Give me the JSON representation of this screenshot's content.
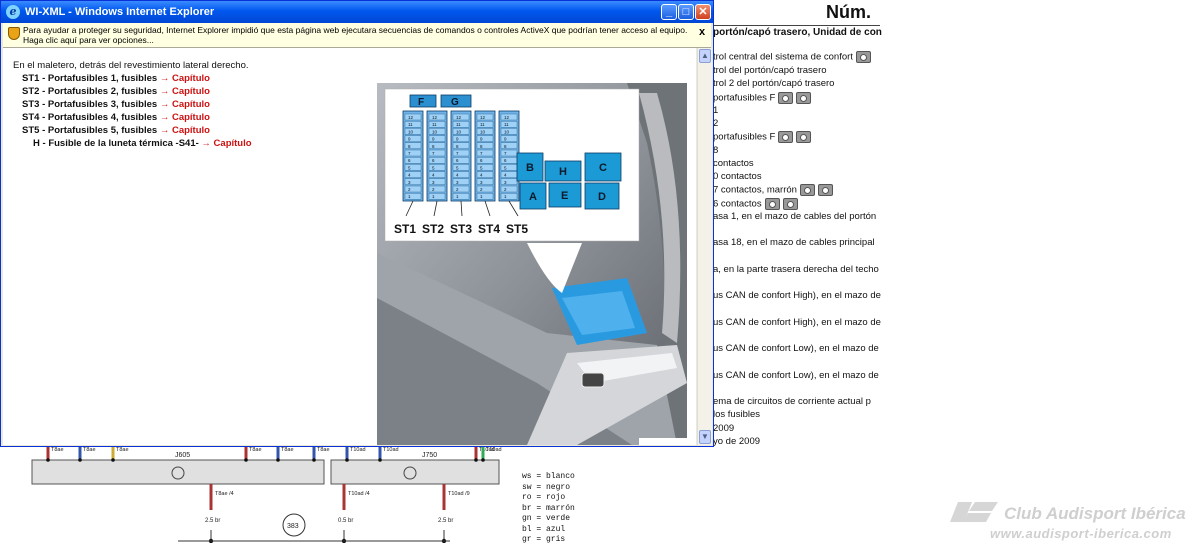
{
  "window": {
    "title": "WI-XML - Windows Internet Explorer",
    "minimize_label": "_",
    "maximize_label": "□",
    "close_label": "✕",
    "icon": "ie-logo-icon"
  },
  "infobar": {
    "text": "Para ayudar a proteger su seguridad, Internet Explorer impidió que esta página web ejecutara secuencias de comandos o controles ActiveX que podrían tener acceso al equipo. Haga clic aquí para ver opciones...",
    "close_label": "x"
  },
  "content": {
    "intro": "En el maletero, detrás del revestimiento lateral derecho.",
    "fuses": [
      {
        "code": "ST1",
        "desc": " - Portafusibles 1, fusibles ",
        "link": "→ Capítulo"
      },
      {
        "code": "ST2",
        "desc": " - Portafusibles 2, fusibles ",
        "link": "→ Capítulo"
      },
      {
        "code": "ST3",
        "desc": " - Portafusibles 3, fusibles ",
        "link": "→ Capítulo"
      },
      {
        "code": "ST4",
        "desc": " - Portafusibles 4, fusibles ",
        "link": "→ Capítulo"
      },
      {
        "code": "ST5",
        "desc": " - Portafusibles 5, fusibles ",
        "link": "→ Capítulo"
      }
    ],
    "fuse_h": {
      "code": "H",
      "desc": " - Fusible de la luneta térmica -S41- ",
      "link": "→ Capítulo"
    }
  },
  "diagram": {
    "top_labels": [
      "F",
      "G"
    ],
    "box_labels": [
      "B",
      "H",
      "C",
      "A",
      "E",
      "D"
    ],
    "holder_labels": [
      "ST1",
      "ST2",
      "ST3",
      "ST4",
      "ST5"
    ],
    "fuse_numbers": [
      "12",
      "11",
      "10",
      "9",
      "8",
      "7",
      "6",
      "5",
      "4",
      "3",
      "2",
      "1"
    ]
  },
  "background_doc": {
    "header": "Núm.",
    "subtitle": "portón/capó trasero, Unidad de con",
    "lines": [
      {
        "text": "trol central del sistema de confort",
        "cams": 1
      },
      {
        "text": "trol del portón/capó trasero",
        "cams": 0
      },
      {
        "text": "trol 2 del portón/capó trasero",
        "cams": 0
      },
      {
        "text": "portafusibles F",
        "cams": 2
      },
      {
        "text": "1",
        "cams": 0
      },
      {
        "text": "2",
        "cams": 0
      },
      {
        "text": "portafusibles F",
        "cams": 2
      },
      {
        "text": "8",
        "cams": 0
      },
      {
        "text": " contactos",
        "cams": 0
      },
      {
        "text": "0 contactos",
        "cams": 0
      },
      {
        "text": "7 contactos, marrón",
        "cams": 2
      },
      {
        "text": "6 contactos",
        "cams": 2
      },
      {
        "text": "asa 1, en el mazo de cables del portón",
        "cams": 0
      },
      {
        "text": "asa 18, en el mazo de cables principal",
        "cams": 0
      },
      {
        "text": "a, en la parte trasera derecha del techo",
        "cams": 0
      },
      {
        "text": "us CAN de confort High), en el mazo de",
        "cams": 0
      },
      {
        "text": "us CAN de confort High), en el mazo de",
        "cams": 0
      },
      {
        "text": "us CAN de confort Low), en el mazo de",
        "cams": 0
      },
      {
        "text": "us CAN de confort Low), en el mazo de",
        "cams": 0
      },
      {
        "text": "ema de circuitos de corriente actual p",
        "cams": 0
      },
      {
        "text": "los fusibles",
        "cams": 0
      },
      {
        "text": "2009",
        "cams": 0
      },
      {
        "text": "yo de 2009",
        "cams": 0
      }
    ]
  },
  "wiring": {
    "modules": [
      "J605",
      "J750"
    ],
    "connectors": [
      "T8ae",
      "T8ae",
      "T8ae",
      "T8ae",
      "T8ae",
      "T8ae",
      "T10ad",
      "T10ad",
      "T10ad",
      "T10ad"
    ],
    "bottom_connectors": [
      "T8ae /4",
      "T10ad /4",
      "T10ad /9"
    ],
    "wire_specs": [
      "2.5 br",
      "0.5 br",
      "2.5 br"
    ],
    "ref_number": "383"
  },
  "legend": [
    {
      "code": "ws",
      "color": "blanco"
    },
    {
      "code": "sw",
      "color": "negro"
    },
    {
      "code": "ro",
      "color": "rojo"
    },
    {
      "code": "br",
      "color": "marrón"
    },
    {
      "code": "gn",
      "color": "verde"
    },
    {
      "code": "bl",
      "color": "azul"
    },
    {
      "code": "gr",
      "color": "gris"
    }
  ],
  "watermark": {
    "name": "Club Audisport Ibérica",
    "url": "www.audisport-iberica.com"
  },
  "colors": {
    "titlebar": "#0058ee",
    "infobar": "#ffffe1",
    "link": "#cc1111",
    "fuse_blue": "#6fb4ea",
    "box_blue": "#1c9ad6"
  }
}
